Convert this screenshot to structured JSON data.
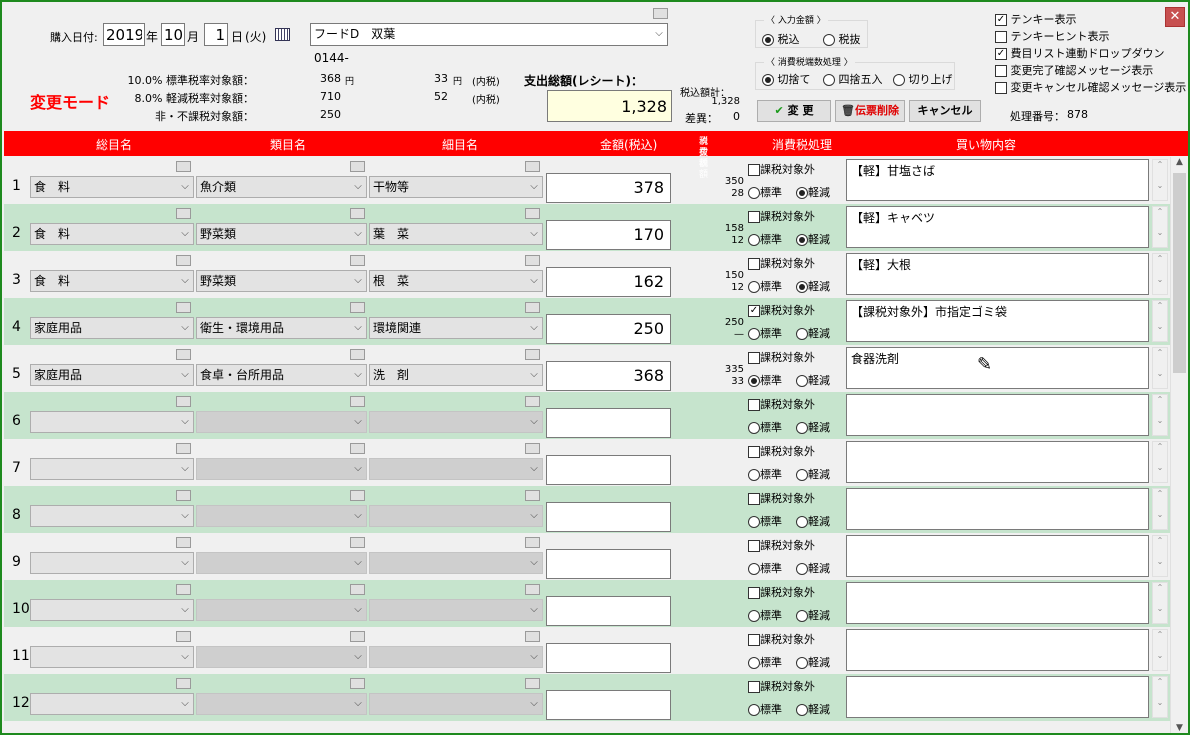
{
  "purchase": {
    "label": "購入日付:",
    "year": "2019",
    "year_unit": "年",
    "month": "10",
    "month_unit": "月",
    "day": "1",
    "day_unit": "日",
    "weekday": "(火)",
    "store": "フードD　双葉",
    "store_code": "0144-"
  },
  "mode": "変更モード",
  "summary": {
    "rows": [
      {
        "label": "10.0% 標準税率対象額：",
        "amount": "368",
        "unit": "円",
        "tax": "33",
        "tax_unit": "円",
        "tax_note": "(内税)"
      },
      {
        "label": "8.0% 軽減税率対象額：",
        "amount": "710",
        "unit": "",
        "tax": "52",
        "tax_unit": "",
        "tax_note": "(内税)"
      },
      {
        "label": "非・不課税対象額：",
        "amount": "250",
        "unit": "",
        "tax": "",
        "tax_unit": "",
        "tax_note": ""
      }
    ],
    "total_label": "支出総額(レシート)：",
    "total_value": "1,328",
    "tax_total_label": "税込額計：",
    "tax_total_value": "1,328",
    "diff_label": "差異：",
    "diff_value": "0"
  },
  "input_amount": {
    "title": "〈 入力金額 〉",
    "options": [
      "税込",
      "税抜"
    ],
    "selected": 0
  },
  "rounding": {
    "title": "〈 消費税端数処理 〉",
    "options": [
      "切捨て",
      "四捨五入",
      "切り上げ"
    ],
    "selected": 0
  },
  "buttons": {
    "change": "変 更",
    "delete": "伝票削除",
    "cancel": "キャンセル"
  },
  "check_options": [
    {
      "label": "テンキー表示",
      "checked": true
    },
    {
      "label": "テンキーヒント表示",
      "checked": false
    },
    {
      "label": "費目リスト連動ドロップダウン",
      "checked": true
    },
    {
      "label": "変更完了確認メッセージ表示",
      "checked": false
    },
    {
      "label": "変更キャンセル確認メッセージ表示",
      "checked": false
    }
  ],
  "process_label": "処理番号：",
  "process_no": "878",
  "columns": {
    "c1": "総目名",
    "c2": "類目名",
    "c3": "細目名",
    "amount": "金額(税込)",
    "tax1": "税抜額",
    "tax2": "消費税額",
    "taxproc": "消費税処理",
    "desc": "買い物内容"
  },
  "tax_exempt_label": "課税対象外",
  "std_label": "標準",
  "red_label": "軽減",
  "rows": [
    {
      "n": "1",
      "c1": "食　料",
      "c2": "魚介類",
      "c3": "干物等",
      "amount": "378",
      "net": "350",
      "tax": "28",
      "exempt": false,
      "rate": "red",
      "desc": "【軽】甘塩さば"
    },
    {
      "n": "2",
      "c1": "食　料",
      "c2": "野菜類",
      "c3": "葉　菜",
      "amount": "170",
      "net": "158",
      "tax": "12",
      "exempt": false,
      "rate": "red",
      "desc": "【軽】キャベツ"
    },
    {
      "n": "3",
      "c1": "食　料",
      "c2": "野菜類",
      "c3": "根　菜",
      "amount": "162",
      "net": "150",
      "tax": "12",
      "exempt": false,
      "rate": "red",
      "desc": "【軽】大根"
    },
    {
      "n": "4",
      "c1": "家庭用品",
      "c2": "衛生・環境用品",
      "c3": "環境関連",
      "amount": "250",
      "net": "250",
      "tax": "—",
      "exempt": true,
      "rate": "none",
      "desc": "【課税対象外】市指定ゴミ袋"
    },
    {
      "n": "5",
      "c1": "家庭用品",
      "c2": "食卓・台所用品",
      "c3": "洗　剤",
      "amount": "368",
      "net": "335",
      "tax": "33",
      "exempt": false,
      "rate": "std",
      "desc": "食器洗剤"
    },
    {
      "n": "6",
      "c1": "",
      "c2": "",
      "c3": "",
      "amount": "",
      "net": "",
      "tax": "",
      "exempt": false,
      "rate": "none",
      "desc": ""
    },
    {
      "n": "7",
      "c1": "",
      "c2": "",
      "c3": "",
      "amount": "",
      "net": "",
      "tax": "",
      "exempt": false,
      "rate": "none",
      "desc": ""
    },
    {
      "n": "8",
      "c1": "",
      "c2": "",
      "c3": "",
      "amount": "",
      "net": "",
      "tax": "",
      "exempt": false,
      "rate": "none",
      "desc": ""
    },
    {
      "n": "9",
      "c1": "",
      "c2": "",
      "c3": "",
      "amount": "",
      "net": "",
      "tax": "",
      "exempt": false,
      "rate": "none",
      "desc": ""
    },
    {
      "n": "10",
      "c1": "",
      "c2": "",
      "c3": "",
      "amount": "",
      "net": "",
      "tax": "",
      "exempt": false,
      "rate": "none",
      "desc": ""
    },
    {
      "n": "11",
      "c1": "",
      "c2": "",
      "c3": "",
      "amount": "",
      "net": "",
      "tax": "",
      "exempt": false,
      "rate": "none",
      "desc": ""
    },
    {
      "n": "12",
      "c1": "",
      "c2": "",
      "c3": "",
      "amount": "",
      "net": "",
      "tax": "",
      "exempt": false,
      "rate": "none",
      "desc": ""
    }
  ],
  "colors": {
    "header": "#ff0000",
    "alt_row": "#c6e4cd",
    "frame": "#1e8a1e",
    "mode": "#ff0000"
  }
}
